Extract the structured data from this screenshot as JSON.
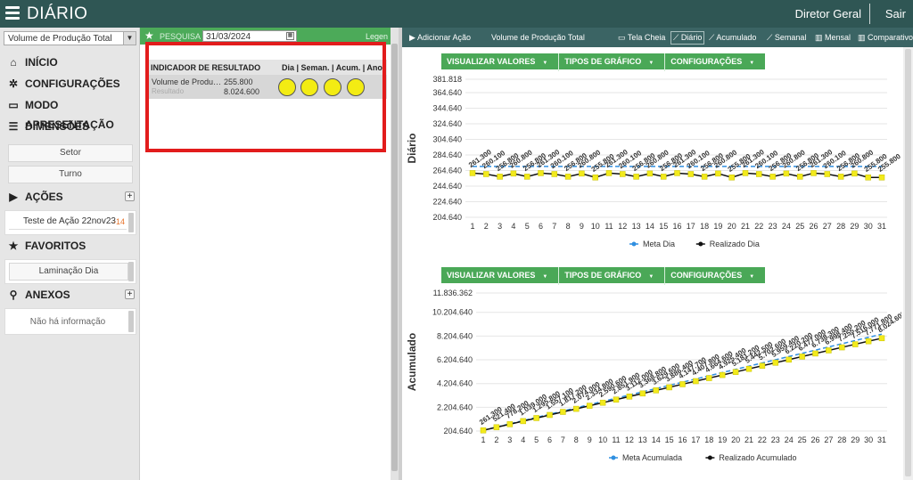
{
  "header": {
    "title": "DIÁRIO",
    "user": "Diretor Geral",
    "logout": "Sair"
  },
  "sidebar": {
    "select_value": "Volume de Produção Total",
    "nav": [
      {
        "label": "INÍCIO",
        "icon": "home-icon"
      },
      {
        "label": "CONFIGURAÇÕES",
        "icon": "gear-icon"
      },
      {
        "label": "MODO APRESENTAÇÃO",
        "icon": "monitor-icon"
      },
      {
        "label": "DIMENSÕES",
        "icon": "database-icon"
      }
    ],
    "dimension_buttons": [
      "Setor",
      "Turno"
    ],
    "actions_title": "AÇÕES",
    "action_item": {
      "label": "Teste de Ação 22nov23",
      "count": "-14"
    },
    "favorites_title": "FAVORITOS",
    "favorite_item": "Laminação Dia",
    "attachments_title": "ANEXOS",
    "attachments_empty": "Não há informação"
  },
  "search": {
    "label": "PESQUISA",
    "date": "31/03/2024",
    "legend": "Legen"
  },
  "indicator": {
    "header": "INDICADOR DE RESULTADO",
    "columns": "Dia | Seman. | Acum. | Ano",
    "row": {
      "name": "Volume de Produç...",
      "sub": "Resultado",
      "value1": "255.800",
      "value2": "8.024.600"
    }
  },
  "toolbar": {
    "add_action": "Adicionar Ação",
    "indicator_name": "Volume de Produção Total",
    "full_screen": "Tela Cheia",
    "daily": "Diário",
    "cumulative": "Acumulado",
    "weekly": "Semanal",
    "monthly": "Mensal",
    "compare": "Comparativo"
  },
  "chart_toolbar": {
    "view_values": "VISUALIZAR VALORES",
    "chart_types": "TIPOS DE GRÁFICO",
    "settings": "CONFIGURAÇÕES"
  },
  "colors": {
    "meta": "#2f8fe0",
    "realizado": "#111111",
    "marker": "#f2ea1c",
    "accent_green": "#4caa59",
    "header_bg": "#2f5654"
  },
  "chart_data": [
    {
      "type": "line",
      "ylabel": "Diário",
      "ylim": [
        204.64,
        381.818
      ],
      "yticks": [
        "381.818",
        "364.640",
        "344.640",
        "324.640",
        "304.640",
        "284.640",
        "264.640",
        "244.640",
        "224.640",
        "204.640"
      ],
      "x": [
        1,
        2,
        3,
        4,
        5,
        6,
        7,
        8,
        9,
        10,
        11,
        12,
        13,
        14,
        15,
        16,
        17,
        18,
        19,
        20,
        21,
        22,
        23,
        24,
        25,
        26,
        27,
        28,
        29,
        30,
        31
      ],
      "series": [
        {
          "name": "Meta Dia",
          "values": [
            270,
            270,
            270,
            270,
            270,
            270,
            270,
            270,
            270,
            270,
            270,
            270,
            270,
            270,
            270,
            270,
            270,
            270,
            270,
            270,
            270,
            270,
            270,
            270,
            270,
            270,
            270,
            270,
            270,
            270,
            270
          ]
        },
        {
          "name": "Realizado Dia",
          "values": [
            261.3,
            260.1,
            256.8,
            260.8,
            256.8,
            261.3,
            260.1,
            256.8,
            260.8,
            255.8,
            261.3,
            260.1,
            256.8,
            260.8,
            256.8,
            261.3,
            260.1,
            256.8,
            260.8,
            255.8,
            261.3,
            260.1,
            256.8,
            260.8,
            256.8,
            261.3,
            260.1,
            256.8,
            260.8,
            255.8,
            255.8
          ]
        }
      ],
      "data_labels": [
        "261.300",
        "260.100",
        "256.800",
        "260.800",
        "256.800",
        "261.300",
        "260.100",
        "256.800",
        "260.800",
        "255.800",
        "261.300",
        "260.100",
        "256.800",
        "260.800",
        "256.800",
        "261.300",
        "260.100",
        "256.800",
        "260.800",
        "255.800",
        "261.300",
        "260.100",
        "256.800",
        "260.800",
        "256.800",
        "261.300",
        "260.100",
        "256.800",
        "260.800",
        "255.800",
        "255.800"
      ]
    },
    {
      "type": "line",
      "ylabel": "Acumulado",
      "ylim": [
        204.64,
        11836.362
      ],
      "yticks": [
        "11.836.362",
        "10.204.640",
        "8.204.640",
        "6.204.640",
        "4.204.640",
        "2.204.640",
        "204.640"
      ],
      "x": [
        1,
        2,
        3,
        4,
        5,
        6,
        7,
        8,
        9,
        10,
        11,
        12,
        13,
        14,
        15,
        16,
        17,
        18,
        19,
        20,
        21,
        22,
        23,
        24,
        25,
        26,
        27,
        28,
        29,
        30,
        31
      ],
      "series": [
        {
          "name": "Meta Acumulada",
          "values": [
            270,
            540,
            810,
            1080,
            1350,
            1620,
            1890,
            2160,
            2430,
            2700,
            2970,
            3240,
            3510,
            3780,
            4050,
            4320,
            4590,
            4860,
            5130,
            5400,
            5670,
            5940,
            6210,
            6480,
            6750,
            7020,
            7290,
            7560,
            7830,
            8100,
            8370
          ]
        },
        {
          "name": "Realizado Acumulado",
          "values": [
            261.3,
            521.4,
            778.2,
            1039,
            1295.8,
            1557.1,
            1817.2,
            2074,
            2334.8,
            2590.6,
            2851.9,
            3112,
            3368.8,
            3629.6,
            3886.4,
            4147.7,
            4407.8,
            4664.6,
            4925.4,
            5181.2,
            5442.5,
            5702.6,
            5959.4,
            6220.2,
            6477,
            6738.3,
            6998.4,
            7255.2,
            7516,
            7771.8,
            8024.6
          ]
        }
      ],
      "data_labels": [
        "261.300",
        "521.400",
        "778.200",
        "1.039.000",
        "1.295.800",
        "1.557.100",
        "1.817.200",
        "2.074.000",
        "2.334.800",
        "2.590.600",
        "2.851.900",
        "3.112.000",
        "3.368.800",
        "3.629.600",
        "3.886.400",
        "4.147.700",
        "4.407.800",
        "4.664.600",
        "4.925.400",
        "5.181.200",
        "5.442.500",
        "5.702.600",
        "5.959.400",
        "6.220.200",
        "6.477.000",
        "6.738.300",
        "6.998.400",
        "7.255.200",
        "7.516.000",
        "7.771.800",
        "8.024.600"
      ]
    }
  ]
}
